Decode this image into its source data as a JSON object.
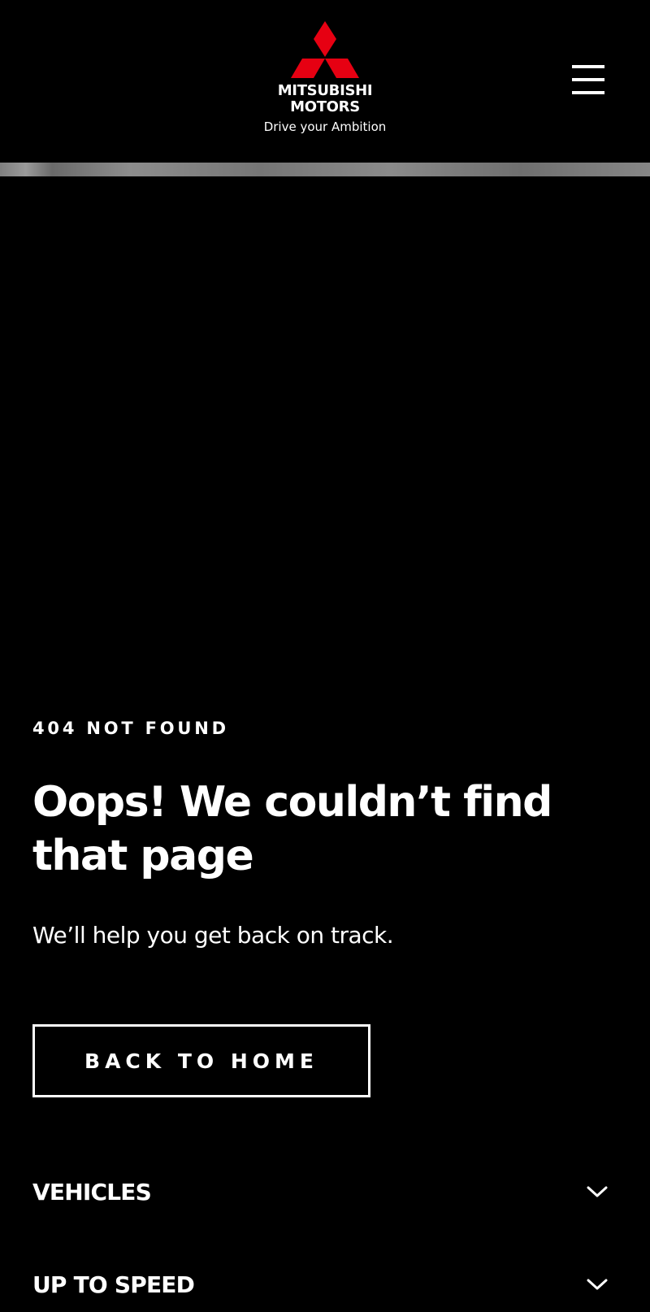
{
  "header": {
    "brand": {
      "line1": "MITSUBISHI",
      "line2": "MOTORS",
      "tagline": "Drive your Ambition",
      "logo_color": "#E60012"
    },
    "menu_icon": "hamburger-menu-icon"
  },
  "main": {
    "error_code": "404 NOT FOUND",
    "heading_line1": "Oops! We couldn’t find",
    "heading_line2": "that page",
    "subtext": "We’ll help you get back on track.",
    "home_button_label": "BACK TO HOME"
  },
  "footer_nav": {
    "items": [
      {
        "label": "VEHICLES",
        "icon": "chevron-down-icon"
      },
      {
        "label": "UP TO SPEED",
        "icon": "chevron-down-icon"
      }
    ]
  },
  "colors": {
    "background": "#000000",
    "text": "#FFFFFF",
    "accent": "#E60012"
  }
}
